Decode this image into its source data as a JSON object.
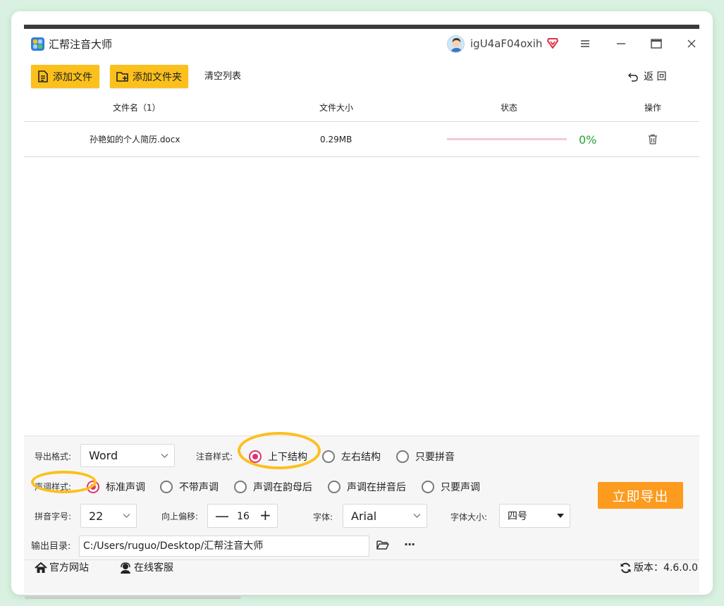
{
  "app": {
    "title": "汇帮注音大师"
  },
  "user": {
    "name": "igU4aF04oxih",
    "avatar_icon": "user-avatar",
    "vip_icon": "vip-badge-icon"
  },
  "window_controls": [
    "menu-icon",
    "minimize-icon",
    "maximize-icon",
    "close-icon"
  ],
  "toolbar": {
    "add_file_label": "添加文件",
    "add_folder_label": "添加文件夹",
    "clear_list_label": "清空列表",
    "back_label": "返  回"
  },
  "table": {
    "headers": {
      "filename": "文件名（1）",
      "filesize": "文件大小",
      "status": "状态",
      "action": "操作"
    },
    "rows": [
      {
        "filename": "孙艳如的个人简历.docx",
        "filesize": "0.29MB",
        "progress": 0,
        "progress_label": "0%",
        "action_icon": "trash-icon"
      }
    ]
  },
  "settings": {
    "export_format": {
      "label": "导出格式:",
      "value": "Word"
    },
    "annotation_style": {
      "label": "注音样式:",
      "options": [
        "上下结构",
        "左右结构",
        "只要拼音"
      ],
      "selected": "上下结构"
    },
    "tone_style": {
      "label": "声调样式:",
      "options": [
        "标准声调",
        "不带声调",
        "声调在韵母后",
        "声调在拼音后",
        "只要声调"
      ],
      "selected": "标准声调"
    },
    "pinyin_size": {
      "label": "拼音字号:",
      "value": "22"
    },
    "offset": {
      "label": "向上偏移:",
      "value": "16",
      "minus": "—",
      "plus": "+"
    },
    "font": {
      "label": "字体:",
      "value": "Arial"
    },
    "font_size": {
      "label": "字体大小:",
      "value": "四号"
    },
    "output_dir": {
      "label": "输出目录:",
      "value": "C:/Users/ruguo/Desktop/汇帮注音大师",
      "more": "···"
    }
  },
  "export_button": "立即导出",
  "footer": {
    "website": "官方网站",
    "support": "在线客服",
    "version_label": "版本：",
    "version": "4.6.0.0"
  },
  "colors": {
    "accent_yellow": "#fcc01c",
    "export_orange": "#fc9b1e",
    "radio_selected": "#e0336b",
    "progress_track": "#f5c9d3",
    "progress_text": "#27a132"
  }
}
